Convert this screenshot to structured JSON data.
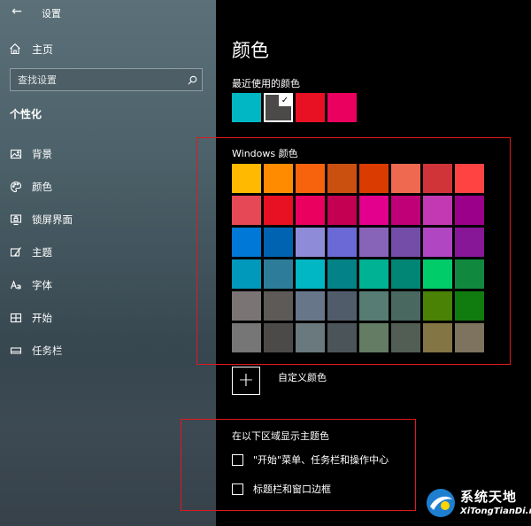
{
  "app": {
    "title": "设置",
    "back_icon": "back-arrow-icon"
  },
  "sidebar": {
    "home_label": "主页",
    "search_placeholder": "查找设置",
    "section_title": "个性化",
    "items": [
      {
        "label": "背景",
        "icon": "background-image-icon"
      },
      {
        "label": "颜色",
        "icon": "palette-icon"
      },
      {
        "label": "锁屏界面",
        "icon": "lock-screen-icon"
      },
      {
        "label": "主题",
        "icon": "theme-brush-icon"
      },
      {
        "label": "字体",
        "icon": "font-icon"
      },
      {
        "label": "开始",
        "icon": "start-menu-icon"
      },
      {
        "label": "任务栏",
        "icon": "taskbar-icon"
      }
    ]
  },
  "main": {
    "title": "颜色",
    "recent_title": "最近使用的颜色",
    "recent_colors": [
      {
        "color": "#00b7c3",
        "selected": false
      },
      {
        "color": "#4c4a48",
        "selected": true
      },
      {
        "color": "#e81123",
        "selected": false
      },
      {
        "color": "#ea005e",
        "selected": false
      }
    ],
    "windows_colors_title": "Windows 颜色",
    "windows_colors": [
      [
        "#ffb900",
        "#ff8c00",
        "#f7630c",
        "#ca5010",
        "#da3b01",
        "#ef6950",
        "#d13438",
        "#ff4343"
      ],
      [
        "#e74856",
        "#e81123",
        "#ea005e",
        "#c30052",
        "#e3008c",
        "#bf0077",
        "#c239b3",
        "#9a0089"
      ],
      [
        "#0078d7",
        "#0063b1",
        "#8e8cd8",
        "#6b69d6",
        "#8764b8",
        "#744da9",
        "#b146c2",
        "#881798"
      ],
      [
        "#0099bc",
        "#2d7d9a",
        "#00b7c3",
        "#038387",
        "#00b294",
        "#018574",
        "#00cc6a",
        "#10893e"
      ],
      [
        "#7a7574",
        "#5d5a58",
        "#68768a",
        "#515c6b",
        "#567c73",
        "#486860",
        "#498205",
        "#107c10"
      ],
      [
        "#767676",
        "#4c4a48",
        "#69797e",
        "#4a5459",
        "#647c64",
        "#525e54",
        "#847545",
        "#7e735f"
      ]
    ],
    "custom_color_label": "自定义颜色",
    "theme_section_title": "在以下区域显示主题色",
    "checkboxes": [
      {
        "label": "\"开始\"菜单、任务栏和操作中心",
        "checked": false
      },
      {
        "label": "标题栏和窗口边框",
        "checked": false
      }
    ]
  },
  "highlight_color": "#e0181f",
  "watermark": {
    "cn": "系统天地",
    "en": "XiTongTianDi.net"
  }
}
